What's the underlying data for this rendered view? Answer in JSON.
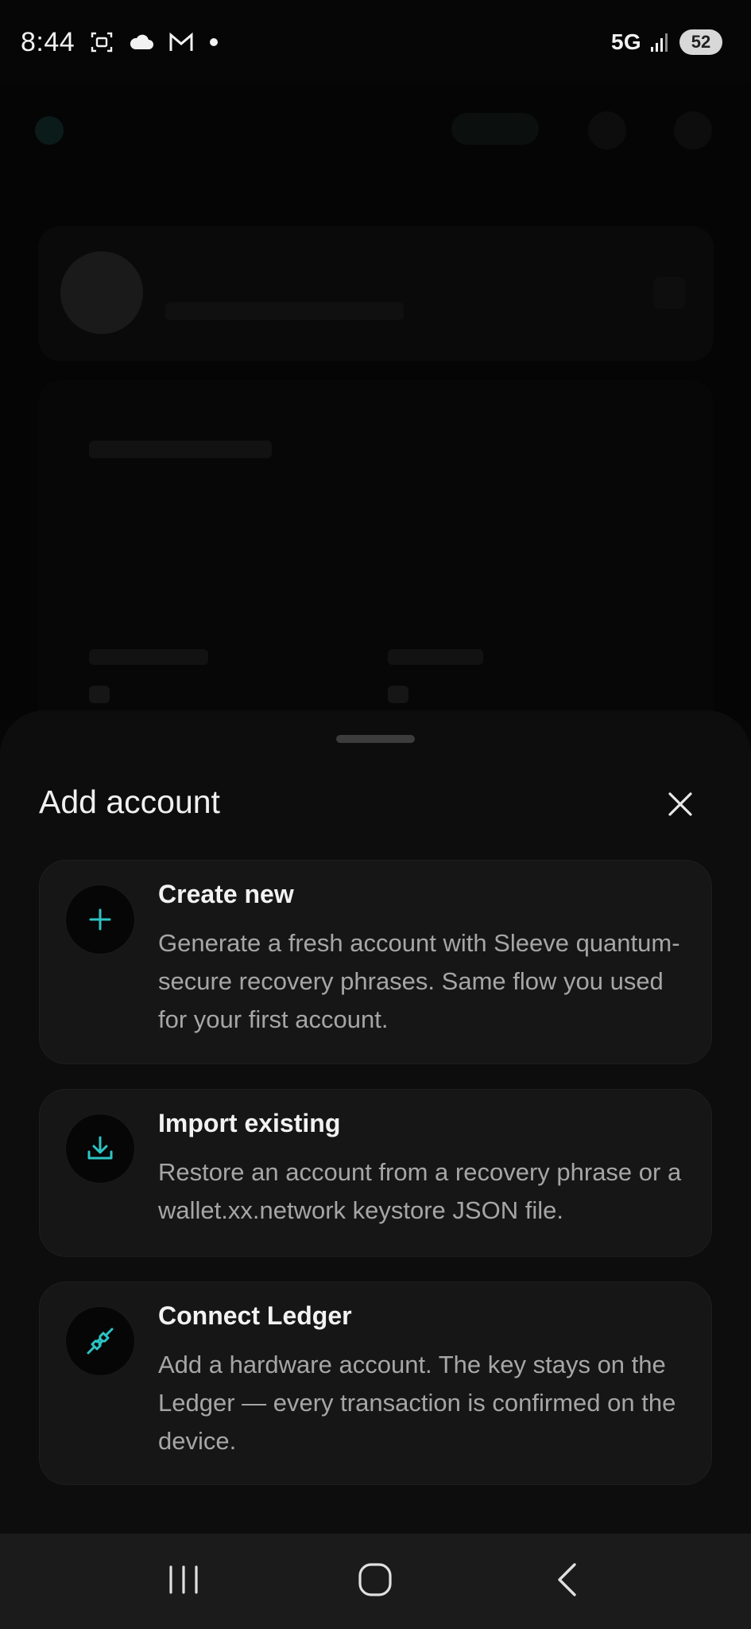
{
  "status_bar": {
    "time": "8:44",
    "network": "5G",
    "battery": "52",
    "icons": [
      "screenshot-icon",
      "cloud-icon",
      "gmail-icon",
      "notification-dot-icon",
      "signal-icon"
    ]
  },
  "sheet": {
    "title": "Add account",
    "close_icon": "close-icon",
    "options": [
      {
        "title": "Create new",
        "description": "Generate a fresh account with Sleeve quantum-secure recovery phrases. Same flow you used for your first account.",
        "icon": "plus-icon"
      },
      {
        "title": "Import existing",
        "description": "Restore an account from a recovery phrase or a wallet.xx.network keystore JSON file.",
        "icon": "download-icon"
      },
      {
        "title": "Connect Ledger",
        "description": "Add a hardware account. The key stays on the Ledger — every transaction is confirmed on the device.",
        "icon": "plug-connect-icon"
      }
    ]
  },
  "nav_bar": {
    "icons": [
      "recent-apps-icon",
      "home-icon",
      "back-icon"
    ]
  },
  "colors": {
    "accent": "#2ec4c4",
    "sheet_bg": "#0d0d0d",
    "card_bg": "#161616",
    "text_primary": "#f2f2f2",
    "text_secondary": "#a6a6a6"
  }
}
